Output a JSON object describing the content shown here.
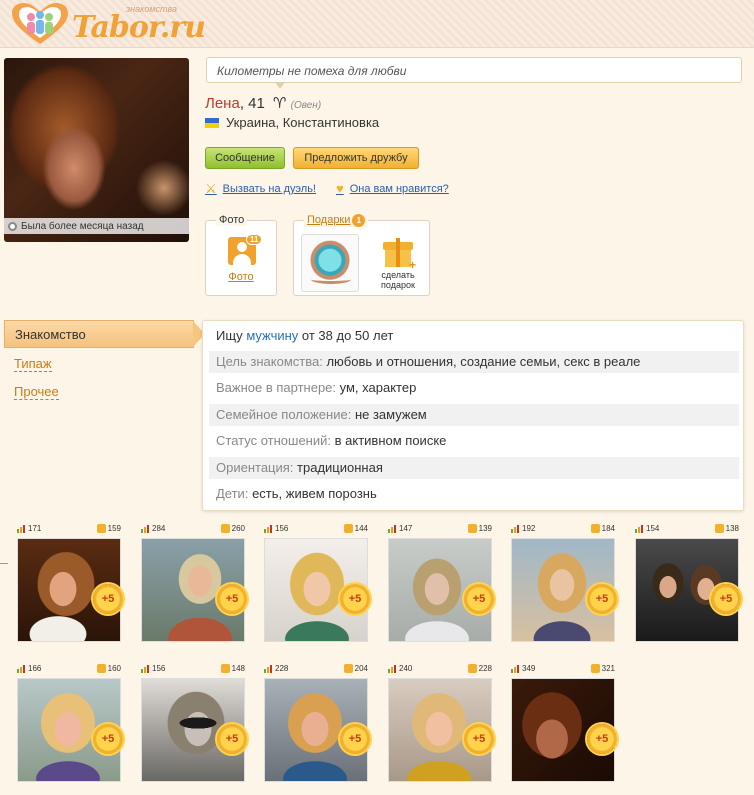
{
  "header": {
    "logo_subtitle": "знакомства",
    "logo_text": "Tabor.ru"
  },
  "profile": {
    "photo_status": "Была более месяца назад",
    "slogan": "Километры не помеха для любви",
    "name": "Лена",
    "age": ", 41",
    "zodiac_symbol": "♈",
    "zodiac_name": "(Овен)",
    "location": "Украина, Константиновка"
  },
  "actions": {
    "message_label": "Сообщение",
    "friend_label": "Предложить дружбу",
    "duel_label": "Вызвать на дуэль!",
    "like_label": "Она вам нравится?"
  },
  "boxes": {
    "photo_title": "Фото",
    "photo_count": "11",
    "photo_link": "Фото",
    "gifts_title": "Подарки",
    "gifts_count": "1",
    "make_gift_label": "сделать подарок"
  },
  "tabs": {
    "active": "Знакомство",
    "tipazh": "Типаж",
    "prochee": "Прочее"
  },
  "info": {
    "seeking_prefix": "Ищу ",
    "seeking_gender": "мужчину",
    "seeking_age": " от 38 до 50 лет",
    "rows": [
      {
        "label": "Цель знакомства:",
        "value": "любовь и отношения, создание семьи, секс в реале"
      },
      {
        "label": "Важное в партнере:",
        "value": "ум, характер"
      },
      {
        "label": "Семейное положение:",
        "value": "не замужем"
      },
      {
        "label": "Статус отношений:",
        "value": "в активном поиске"
      },
      {
        "label": "Ориентация:",
        "value": "традиционная"
      },
      {
        "label": "Дети:",
        "value": "есть, живем порознь"
      }
    ]
  },
  "gallery": {
    "plus_label": "+5",
    "photos": [
      {
        "views": "171",
        "likes": "159"
      },
      {
        "views": "284",
        "likes": "260"
      },
      {
        "views": "156",
        "likes": "144"
      },
      {
        "views": "147",
        "likes": "139"
      },
      {
        "views": "192",
        "likes": "184"
      },
      {
        "views": "154",
        "likes": "138"
      },
      {
        "views": "166",
        "likes": "160"
      },
      {
        "views": "156",
        "likes": "148"
      },
      {
        "views": "228",
        "likes": "204"
      },
      {
        "views": "240",
        "likes": "228"
      },
      {
        "views": "349",
        "likes": "321"
      }
    ]
  },
  "colors": {
    "accent_orange": "#f2a12b",
    "link_blue": "#2a5db0",
    "name_red": "#c0392b",
    "button_green": "#8fbf2d"
  }
}
